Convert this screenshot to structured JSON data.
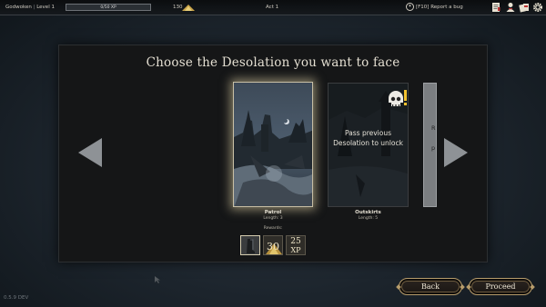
{
  "topbar": {
    "player_name": "Godwoken",
    "level": "Level 1",
    "xp_text": "0/50 XP",
    "xp_progress": 0,
    "gold": "130",
    "act": "Act 1",
    "bug_key": "F10",
    "bug_label": "[F10] Report a bug",
    "icons": [
      "scroll-icon",
      "character-icon",
      "cards-icon",
      "settings-gear-icon"
    ]
  },
  "main": {
    "title": "Choose the Desolation you want to face",
    "cards": [
      {
        "name": "Patrol",
        "length": "Length: 3",
        "selected": true,
        "locked": false
      },
      {
        "name": "Outskirts",
        "length": "Length: 5",
        "selected": false,
        "locked": true,
        "lock_text_1": "Pass previous",
        "lock_text_2": "Desolation to unlock"
      },
      {
        "name": "",
        "partial_text_1": "R",
        "partial_text_2": "p"
      }
    ],
    "rewards_label": "Rewards:",
    "rewards": [
      {
        "icon": "boots-icon",
        "value": ""
      },
      {
        "icon": "gold-pile-icon",
        "value": "30"
      },
      {
        "icon": "xp-icon",
        "value": "25",
        "unit": "XP"
      }
    ]
  },
  "buttons": {
    "back": "Back",
    "proceed": "Proceed"
  },
  "version": "0.5.9 DEV",
  "colors": {
    "accent_gold": "#b69c6b",
    "arrow_grey": "#8e9296",
    "skull_alert": "#f2c230"
  }
}
